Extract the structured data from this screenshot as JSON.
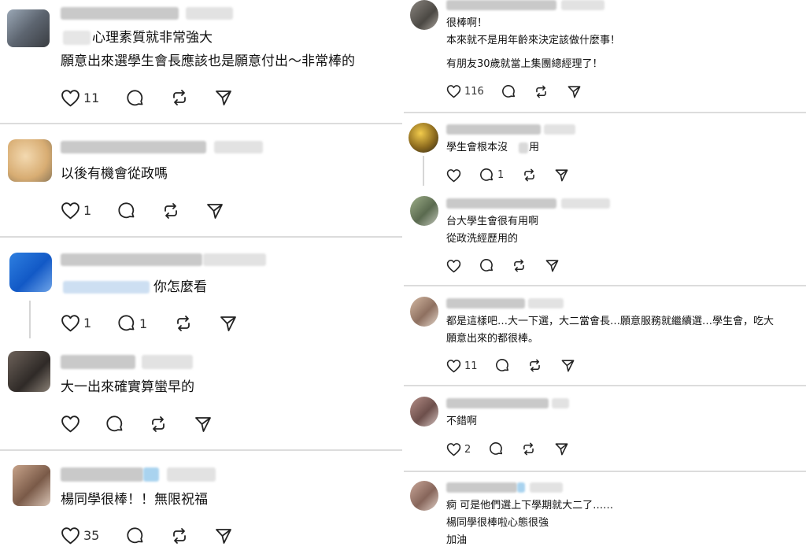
{
  "left": {
    "posts": [
      {
        "lines": [
          "心理素質就非常強大",
          "願意出來選學生會長應該也是願意付出～非常棒的"
        ],
        "likes": "11"
      },
      {
        "lines": [
          "以後有機會從政嗎"
        ],
        "likes": "1"
      },
      {
        "lines": [
          "你怎麼看"
        ],
        "likes": "1",
        "replies": "1"
      },
      {
        "lines": [
          "大一出來確實算蠻早的"
        ]
      },
      {
        "lines": [
          "楊同學很棒！！無限祝福"
        ],
        "likes": "35"
      }
    ]
  },
  "right": {
    "posts": [
      {
        "lines": [
          "很棒啊！",
          "本來就不是用年齡來決定該做什麼事！",
          "有朋友30歲就當上集團總經理了！"
        ],
        "likes": "116"
      },
      {
        "lines": [
          "學生會根本沒",
          "用"
        ],
        "replies": "1"
      },
      {
        "lines": [
          "台大學生會很有用啊",
          "從政洗經歷用的"
        ]
      },
      {
        "lines": [
          "都是這樣吧…大一下選，大二當會長…願意服務就繼續選…學生會，吃大",
          "願意出來的都很棒。"
        ],
        "likes": "11"
      },
      {
        "lines": [
          "不錯啊"
        ],
        "likes": "2"
      },
      {
        "lines": [
          "痾 可是他們選上下學期就大二了……",
          "楊同學很棒啦心態很強",
          "加油"
        ]
      }
    ]
  }
}
